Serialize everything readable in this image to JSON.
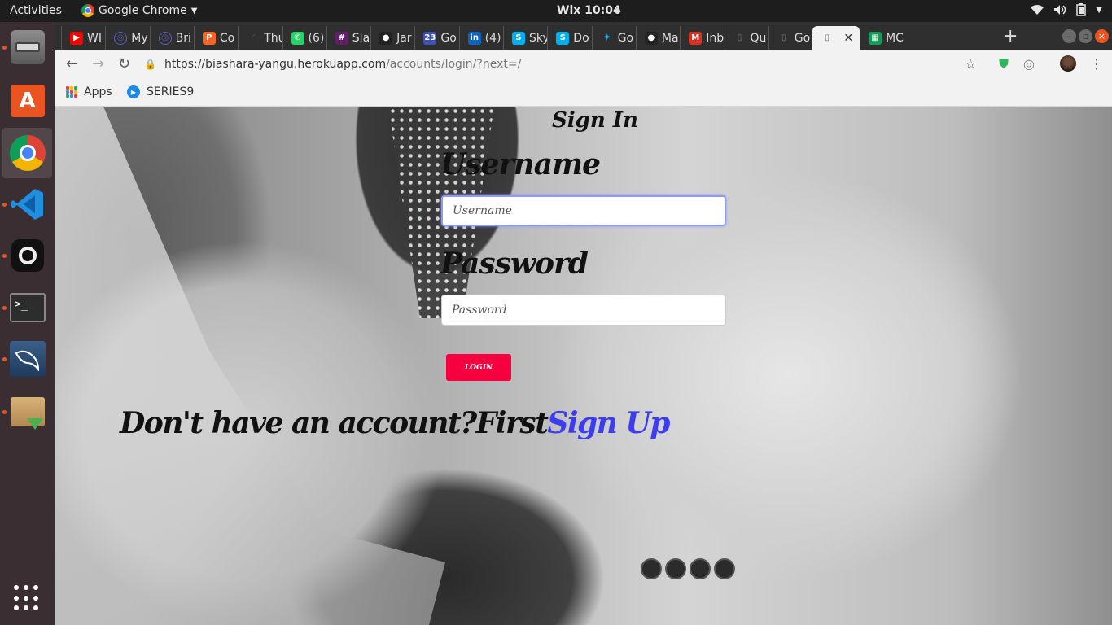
{
  "topbar": {
    "activities": "Activities",
    "app_name": "Google Chrome",
    "clock": "Wix 10:04"
  },
  "dock": {
    "items": [
      {
        "name": "files",
        "icon": "file-cabinet-icon",
        "running": true
      },
      {
        "name": "software",
        "icon": "shopping-bag-icon",
        "running": false
      },
      {
        "name": "chrome",
        "icon": "chrome-icon",
        "running": true
      },
      {
        "name": "vscode",
        "icon": "vscode-icon",
        "running": true
      },
      {
        "name": "screenshot",
        "icon": "camera-icon",
        "running": true
      },
      {
        "name": "terminal",
        "icon": "terminal-icon",
        "running": true
      },
      {
        "name": "mysql-workbench",
        "icon": "dolphin-icon",
        "running": true
      },
      {
        "name": "archive-installer",
        "icon": "package-icon",
        "running": true
      }
    ],
    "show_apps_icon": "grid-icon"
  },
  "browser": {
    "tabs": [
      {
        "label": "WI",
        "favicon": "youtube-icon",
        "color": "#ff0000"
      },
      {
        "label": "My",
        "favicon": "globe-icon",
        "color": "#5b5fc7"
      },
      {
        "label": "Bri",
        "favicon": "globe-icon",
        "color": "#5b5fc7"
      },
      {
        "label": "Co",
        "favicon": "p-icon",
        "color": "#f26522"
      },
      {
        "label": "Thu",
        "favicon": "loading-icon",
        "color": "#4a6b3a"
      },
      {
        "label": "(6)",
        "favicon": "whatsapp-icon",
        "color": "#25d366"
      },
      {
        "label": "Sla",
        "favicon": "slack-icon",
        "color": "#611f69"
      },
      {
        "label": "Jar",
        "favicon": "github-icon",
        "color": "#222222"
      },
      {
        "label": "Go",
        "favicon": "calendar-icon",
        "color": "#3f51b5"
      },
      {
        "label": "(4)",
        "favicon": "linkedin-icon",
        "color": "#0a66c2"
      },
      {
        "label": "Sky",
        "favicon": "skype-icon",
        "color": "#00aff0"
      },
      {
        "label": "Do",
        "favicon": "skype-icon",
        "color": "#00aff0"
      },
      {
        "label": "Go",
        "favicon": "twitter-icon",
        "color": "#1da1f2"
      },
      {
        "label": "Ma",
        "favicon": "github-icon",
        "color": "#222222"
      },
      {
        "label": "Inb",
        "favicon": "gmail-icon",
        "color": "#d93025"
      },
      {
        "label": "Qu",
        "favicon": "document-icon",
        "color": "#777777"
      },
      {
        "label": "Go",
        "favicon": "document-icon",
        "color": "#777777"
      },
      {
        "label": "",
        "favicon": "document-icon",
        "color": "#777777",
        "active": true
      },
      {
        "label": "MC",
        "favicon": "sheets-icon",
        "color": "#0f9d58"
      }
    ],
    "url_host": "https://biashara-yangu.herokuapp.com",
    "url_path": "/accounts/login/?next=/",
    "bookmarks": [
      {
        "label": "Apps",
        "icon": "apps-grid-icon"
      },
      {
        "label": "SERIES9",
        "icon": "play-circle-icon",
        "color": "#1e88e5"
      }
    ]
  },
  "page": {
    "title": "Sign In",
    "username_label": "Username",
    "username_placeholder": "Username",
    "password_label": "Password",
    "password_placeholder": "Password",
    "login_button": "login",
    "login_color": "#f7003f",
    "signup_prefix": "Don't have an account?First",
    "signup_link": "Sign Up",
    "signup_color": "#3c3cf0"
  }
}
